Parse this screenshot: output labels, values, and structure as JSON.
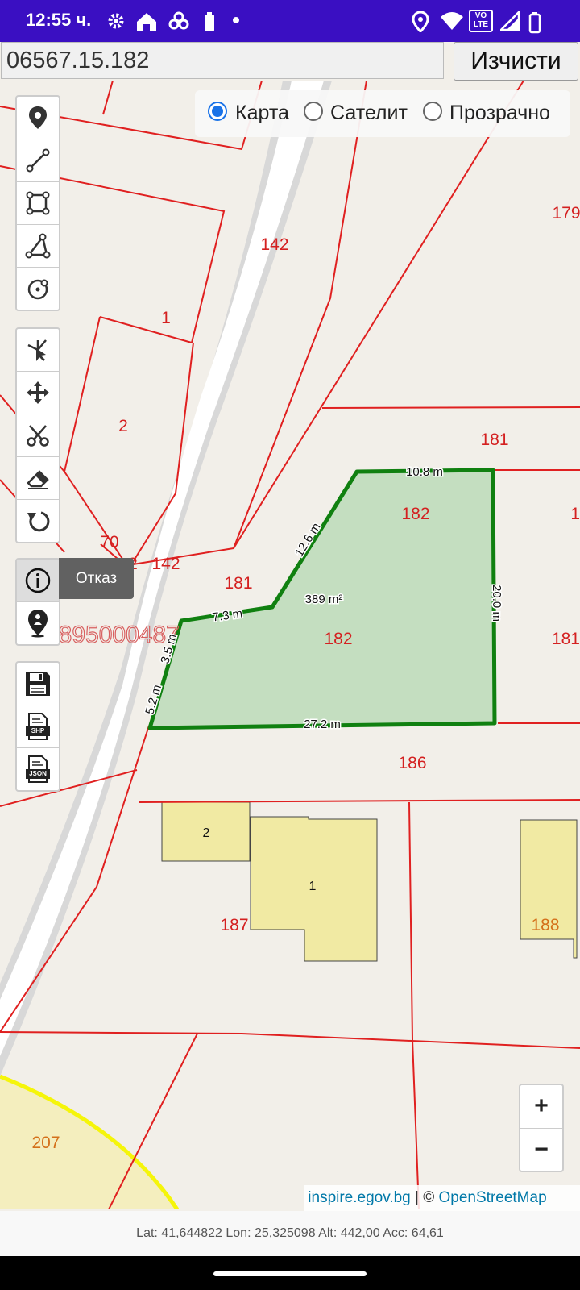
{
  "status_bar": {
    "time": "12:55 ч.",
    "icons": [
      "settings-icon",
      "home-icon",
      "fan-icon",
      "battery-saver-icon",
      "dot-icon",
      "location-icon",
      "wifi-icon",
      "volte-icon",
      "signal-icon",
      "battery-icon"
    ],
    "volte_top": "VO",
    "volte_bottom": "LTE",
    "bg_color": "#3a0fc2"
  },
  "search": {
    "value": "06567.15.182",
    "clear_label": "Изчисти"
  },
  "layers": {
    "options": [
      {
        "label": "Карта",
        "selected": true
      },
      {
        "label": "Сателит",
        "selected": false
      },
      {
        "label": "Прозрачно",
        "selected": false
      }
    ]
  },
  "toolbars": {
    "draw": [
      "marker-icon",
      "polyline-icon",
      "rectangle-icon",
      "polygon-icon",
      "circle-icon"
    ],
    "edit": [
      "select-icon",
      "move-icon",
      "cut-icon",
      "eraser-icon",
      "undo-icon"
    ],
    "info": [
      "info-icon",
      "location-person-icon"
    ],
    "export": [
      "save-icon",
      "shp-file-icon",
      "json-file-icon"
    ],
    "shp_text": "SHP",
    "json_text": "JSON"
  },
  "tooltip": {
    "label": "Отказ"
  },
  "map": {
    "parcel_labels": [
      "142",
      "179",
      "1",
      "2",
      "181",
      "182",
      "70",
      "2",
      "142",
      "181",
      "182",
      "181",
      "186",
      "187",
      "188",
      "207",
      "1",
      "1",
      "1"
    ],
    "building_labels": [
      "2",
      "1"
    ],
    "measurements": {
      "area": "389 m²",
      "top": "10.8 m",
      "right": "20.0 m",
      "bottom": "27.2 m",
      "left_upper": "12.6 m",
      "notch": "7.3 m",
      "left_short": "3.5 m",
      "left_lower": "5.2 m"
    },
    "watermark": "0895000487",
    "colors": {
      "selection_fill": "#c4dec0",
      "selection_stroke": "#108010",
      "parcel_line": "#e02020",
      "building": "#f1eaa3",
      "label_red": "#d42020",
      "label_orange": "#d4701a"
    }
  },
  "zoom": {
    "in": "+",
    "out": "−"
  },
  "attribution": {
    "source": "inspire.egov.bg",
    "separator": " | © ",
    "osm": "OpenStreetMap"
  },
  "coords": {
    "text": "Lat: 41,644822 Lon: 25,325098 Alt: 442,00 Acc: 64,61"
  }
}
